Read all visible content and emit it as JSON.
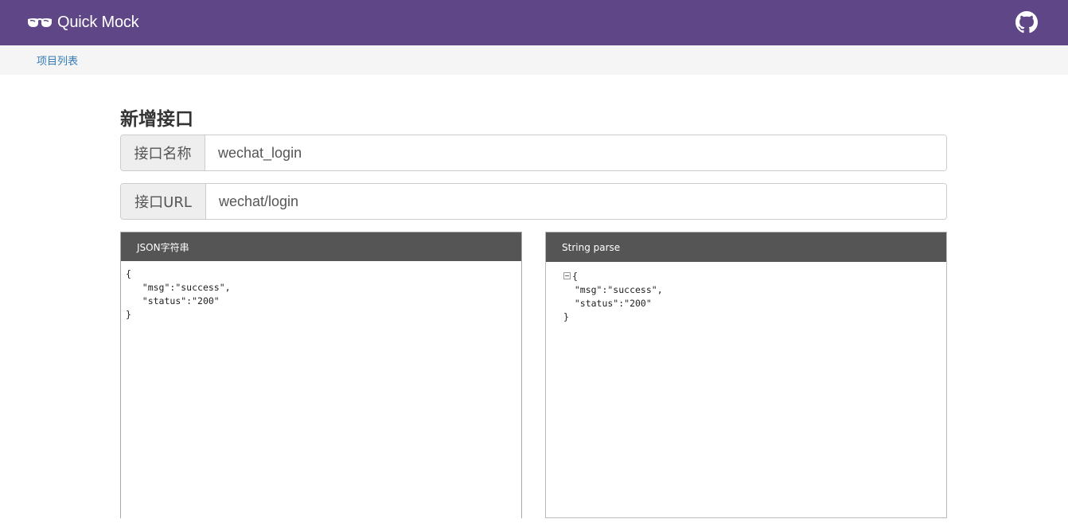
{
  "navbar": {
    "brand": "Quick Mock",
    "brand_icon": "sunglasses-icon",
    "github_icon": "github-icon",
    "bg_color": "#5f4686"
  },
  "breadcrumb": {
    "project_list": "项目列表"
  },
  "page": {
    "title": "新增接口"
  },
  "form": {
    "name_label": "接口名称",
    "name_value": "wechat_login",
    "url_label": "接口URL",
    "url_value": "wechat/login"
  },
  "left_panel": {
    "header": "JSON字符串",
    "content": "{\n   \"msg\":\"success\",\n   \"status\":\"200\"\n}"
  },
  "right_panel": {
    "header": "String parse",
    "open_brace": "{",
    "line_msg": "  \"msg\":\"success\",",
    "line_status": "  \"status\":\"200\"",
    "close_brace": "}"
  }
}
